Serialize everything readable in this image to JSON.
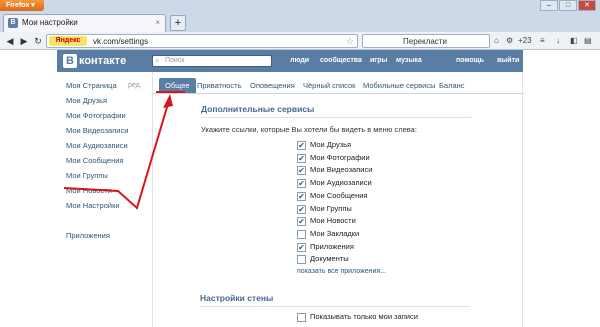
{
  "browser": {
    "menu_label": "Firefox",
    "tab_title": "Мои настройки",
    "tab_favicon": "В",
    "tab_close": "×",
    "new_tab": "+",
    "url_brand": "Яндекс",
    "url": "vk.com/settings",
    "search_label": "Перекласти",
    "counter": "+23"
  },
  "vk": {
    "logo_box": "В",
    "logo_text": "контакте",
    "search_placeholder": "Поиск",
    "menu": [
      "люди",
      "сообщества",
      "игры",
      "музыка",
      "помощь",
      "выйти"
    ]
  },
  "sidebar": {
    "items": [
      "Моя Страница",
      "Мои Друзья",
      "Мои Фотографии",
      "Мои Видеозаписи",
      "Мои Аудиозаписи",
      "Мои Сообщения",
      "Мои Группы",
      "Мои Новости",
      "Мои Настройки",
      "",
      "Приложения"
    ],
    "edit_label": "ред."
  },
  "tabs": [
    "Общее",
    "Приватность",
    "Оповещения",
    "Чёрный список",
    "Мобильные сервисы",
    "Баланс"
  ],
  "section1": {
    "title": "Дополнительные сервисы",
    "desc": "Укажите ссылки, которые Вы хотели бы видеть в меню слева:",
    "items": [
      {
        "label": "Мои Друзья",
        "checked": true
      },
      {
        "label": "Мои Фотографии",
        "checked": true
      },
      {
        "label": "Мои Видеозаписи",
        "checked": true
      },
      {
        "label": "Мои Аудиозаписи",
        "checked": true
      },
      {
        "label": "Мои Сообщения",
        "checked": true
      },
      {
        "label": "Мои Группы",
        "checked": true
      },
      {
        "label": "Мои Новости",
        "checked": true
      },
      {
        "label": "Мои Закладки",
        "checked": false
      },
      {
        "label": "Приложения",
        "checked": true
      },
      {
        "label": "Документы",
        "checked": false
      }
    ],
    "show_all": "показать все приложения..."
  },
  "section2": {
    "title": "Настройки стены",
    "option": "Показывать только мои записи"
  },
  "colors": {
    "vk_blue": "#597da3",
    "annotation": "#d9141b"
  }
}
